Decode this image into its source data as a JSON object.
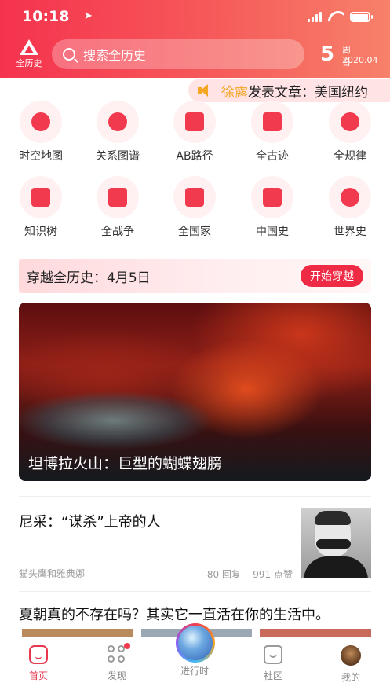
{
  "status_bar": {
    "time": "10:18"
  },
  "header": {
    "logo_text": "全历史",
    "search_placeholder": "搜索全历史",
    "date_day": "5",
    "weekday": "周日",
    "date_ymd": "2020.04"
  },
  "ticker": {
    "author": "徐露",
    "message": "发表文章：美国纽约"
  },
  "features": [
    {
      "label": "时空地图",
      "icon": "map-pin-icon"
    },
    {
      "label": "关系图谱",
      "icon": "network-icon"
    },
    {
      "label": "AB路径",
      "icon": "route-icon"
    },
    {
      "label": "全古迹",
      "icon": "temple-icon"
    },
    {
      "label": "全规律",
      "icon": "orbit-icon"
    },
    {
      "label": "知识树",
      "icon": "list-icon"
    },
    {
      "label": "全战争",
      "icon": "swords-icon"
    },
    {
      "label": "全国家",
      "icon": "flag-icon"
    },
    {
      "label": "中国史",
      "icon": "pavilion-icon"
    },
    {
      "label": "世界史",
      "icon": "globe-icon"
    }
  ],
  "banner": {
    "text": "穿越全历史：4月5日",
    "button": "开始穿越"
  },
  "hero": {
    "caption": "坦博拉火山：巨型的蝴蝶翅膀"
  },
  "article": {
    "title": "尼采：“谋杀”上帝的人",
    "author": "猫头鹰和雅典娜",
    "replies": "80 回复",
    "likes": "991 点赞"
  },
  "article2": {
    "title": "夏朝真的不存在吗？其实它一直活在你的生活中。"
  },
  "tabs": [
    {
      "label": "首页",
      "icon": "home-icon",
      "active": true
    },
    {
      "label": "发现",
      "icon": "discover-icon",
      "badge": true
    },
    {
      "label": "进行时",
      "icon": "globe-button-icon"
    },
    {
      "label": "社区",
      "icon": "community-icon"
    },
    {
      "label": "我的",
      "icon": "avatar-icon"
    }
  ],
  "colors": {
    "accent": "#f23a4f",
    "ticker_author": "#f5a623"
  }
}
